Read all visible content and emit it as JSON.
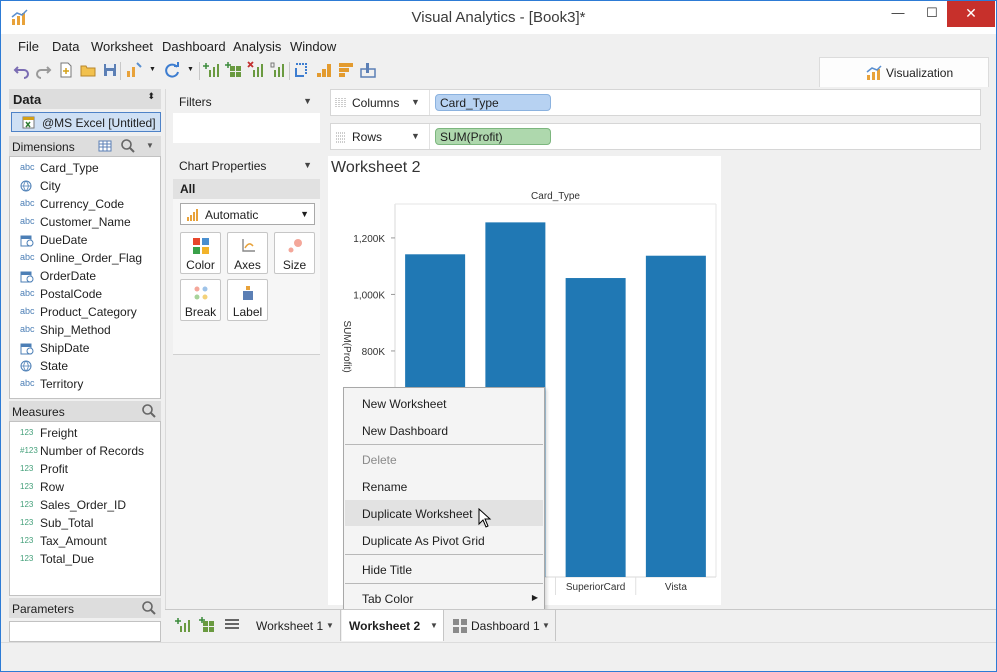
{
  "app": {
    "title": "Visual Analytics - [Book3]*",
    "close_glyph": "✕",
    "min_glyph": "—",
    "max_glyph": "☐"
  },
  "menu": [
    "File",
    "Data",
    "Worksheet",
    "Dashboard",
    "Analysis",
    "Window"
  ],
  "visualization_tab": "Visualization",
  "data_panel": {
    "header": "Data",
    "datasource": "@MS Excel [Untitled]",
    "dimensions_header": "Dimensions",
    "dimensions": [
      {
        "type": "abc",
        "name": "Card_Type"
      },
      {
        "type": "geo",
        "name": "City"
      },
      {
        "type": "abc",
        "name": "Currency_Code"
      },
      {
        "type": "abc",
        "name": "Customer_Name"
      },
      {
        "type": "date",
        "name": "DueDate"
      },
      {
        "type": "abc",
        "name": "Online_Order_Flag"
      },
      {
        "type": "date",
        "name": "OrderDate"
      },
      {
        "type": "abc",
        "name": "PostalCode"
      },
      {
        "type": "abc",
        "name": "Product_Category"
      },
      {
        "type": "abc",
        "name": "Ship_Method"
      },
      {
        "type": "date",
        "name": "ShipDate"
      },
      {
        "type": "geo",
        "name": "State"
      },
      {
        "type": "abc",
        "name": "Territory"
      }
    ],
    "measures_header": "Measures",
    "measures": [
      {
        "type": "123",
        "name": "Freight"
      },
      {
        "type": "#123",
        "name": "Number of Records"
      },
      {
        "type": "123",
        "name": "Profit"
      },
      {
        "type": "123",
        "name": "Row"
      },
      {
        "type": "123",
        "name": "Sales_Order_ID"
      },
      {
        "type": "123",
        "name": "Sub_Total"
      },
      {
        "type": "123",
        "name": "Tax_Amount"
      },
      {
        "type": "123",
        "name": "Total_Due"
      }
    ],
    "parameters_header": "Parameters"
  },
  "filters": {
    "header": "Filters"
  },
  "chart_properties": {
    "header": "Chart Properties",
    "all_label": "All",
    "mark_type": "Automatic",
    "buttons": [
      "Color",
      "Axes",
      "Size",
      "Break",
      "Label"
    ]
  },
  "shelves": {
    "columns": {
      "label": "Columns",
      "pill": "Card_Type"
    },
    "rows": {
      "label": "Rows",
      "pill": "SUM(Profit)"
    }
  },
  "worksheet": {
    "title": "Worksheet 2",
    "bar_color": "#2078b4"
  },
  "chart_data": {
    "type": "bar",
    "title": "Card_Type",
    "xlabel": "",
    "ylabel": "SUM(Profit)",
    "categories": [
      "",
      "",
      "SuperiorCard",
      "Vista"
    ],
    "values": [
      1142000,
      1255000,
      1058000,
      1137000
    ],
    "ylim": [
      0,
      1320000
    ],
    "yticks": [
      800000,
      1000000,
      1200000
    ],
    "ytick_labels": [
      "800K",
      "1,000K",
      "1,200K"
    ],
    "grid": false
  },
  "context_menu": {
    "items": [
      {
        "label": "New Worksheet",
        "disabled": false
      },
      {
        "label": "New Dashboard",
        "disabled": false
      },
      {
        "label": "Delete",
        "disabled": true
      },
      {
        "label": "Rename",
        "disabled": false
      },
      {
        "label": "Duplicate Worksheet",
        "disabled": false,
        "hover": true
      },
      {
        "label": "Duplicate As Pivot Grid",
        "disabled": false
      },
      {
        "label": "Hide Title",
        "disabled": false
      },
      {
        "label": "Tab Color",
        "disabled": false,
        "submenu": true
      }
    ],
    "submenu_glyph": "▶"
  },
  "tabs": [
    {
      "label": "Worksheet 1",
      "active": false
    },
    {
      "label": "Worksheet 2",
      "active": true
    },
    {
      "label": "Dashboard 1",
      "active": false
    }
  ],
  "glyphs": {
    "dropdown": "▼",
    "sort": "⬍"
  },
  "colors": {
    "accent": "#2d7bd5",
    "close": "#c7302b",
    "dimension_pill": "#b7d2f2",
    "measure_pill": "#aed8ad"
  }
}
